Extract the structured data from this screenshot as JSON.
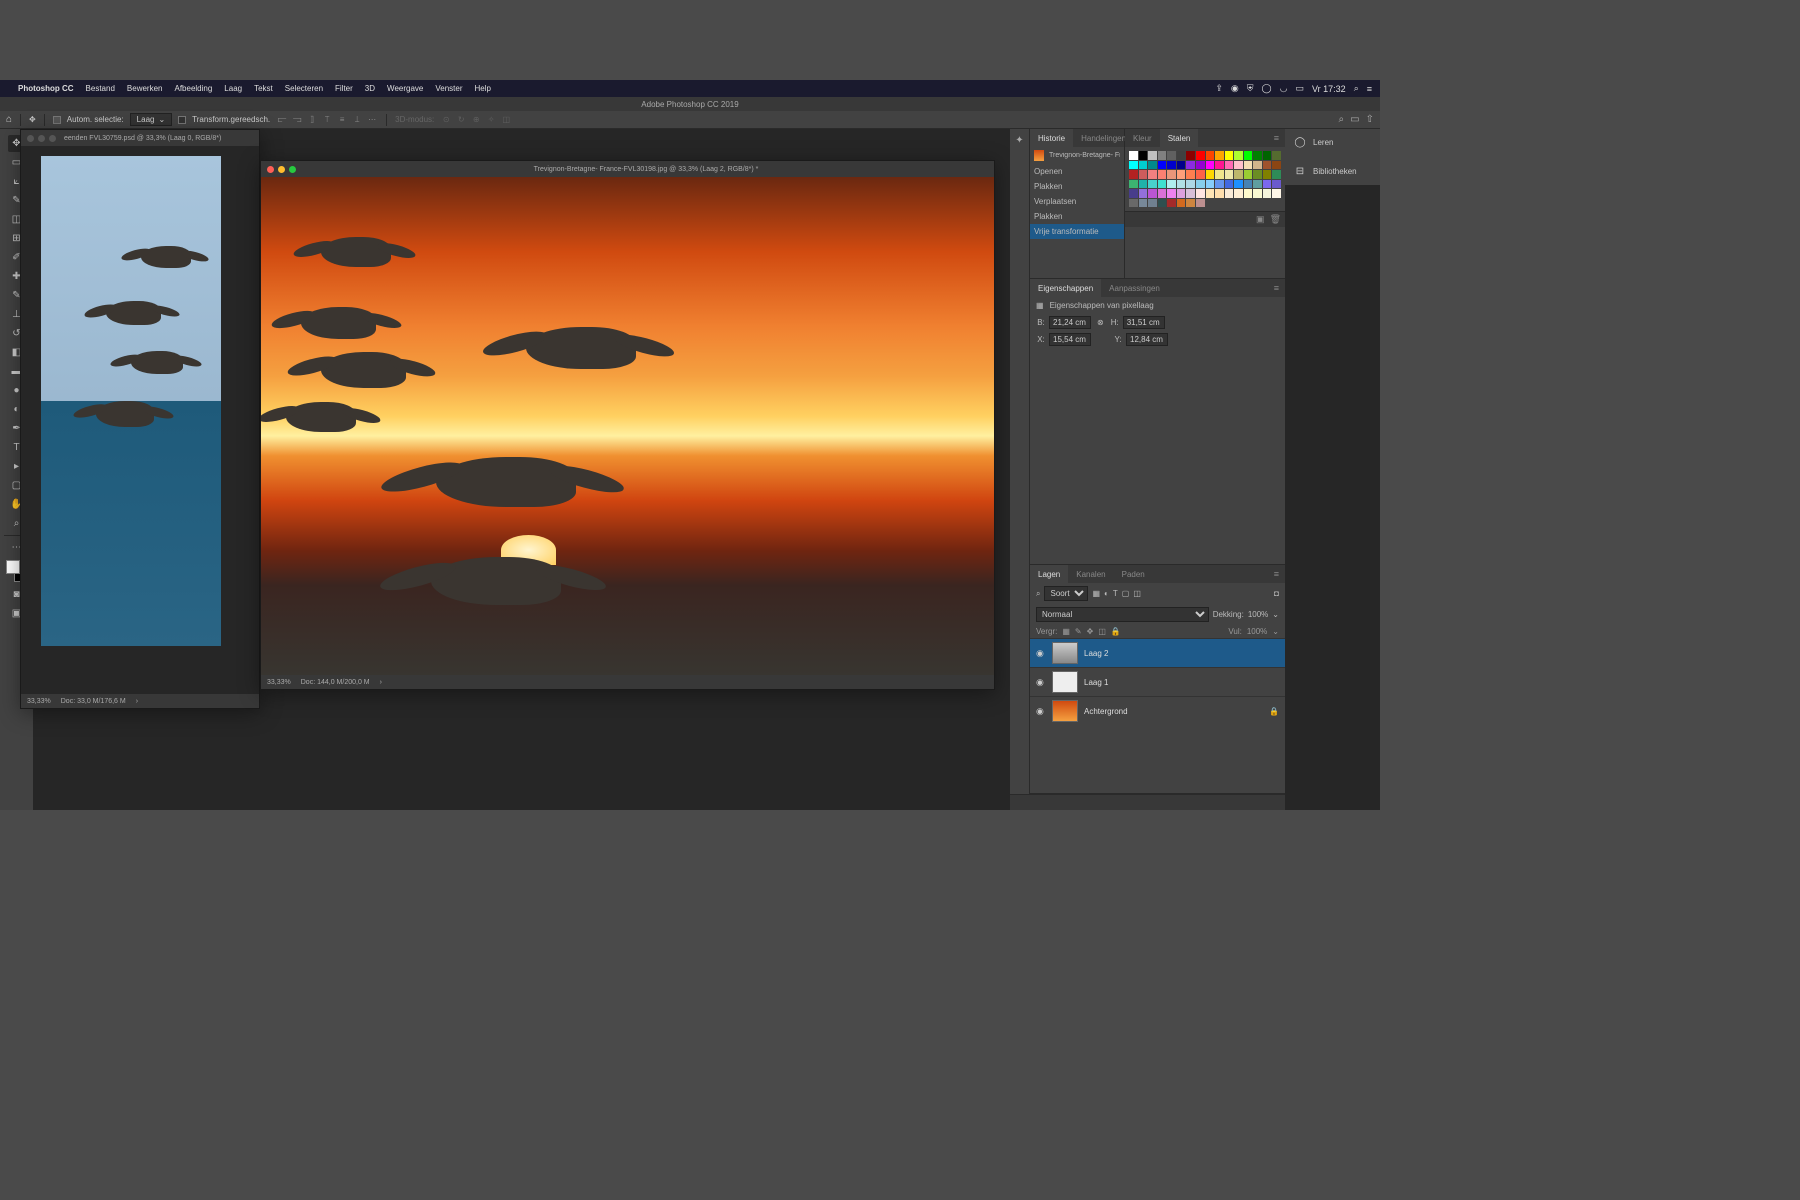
{
  "menubar": {
    "app": "Photoshop CC",
    "items": [
      "Bestand",
      "Bewerken",
      "Afbeelding",
      "Laag",
      "Tekst",
      "Selecteren",
      "Filter",
      "3D",
      "Weergave",
      "Venster",
      "Help"
    ],
    "clock": "Vr 17:32"
  },
  "titlebar": "Adobe Photoshop CC 2019",
  "optbar": {
    "auto_select": "Autom. selectie:",
    "auto_target": "Laag",
    "transform": "Transform.gereedsch.",
    "mode_3d": "3D-modus:"
  },
  "doc1": {
    "tab": "eenden FVL30759.psd @ 33,3% (Laag 0, RGB/8*)",
    "zoom": "33,33%",
    "docsize": "Doc: 33,0 M/176,6 M"
  },
  "doc2": {
    "tab": "Trevignon-Bretagne- France-FVL30198.jpg @ 33,3% (Laag 2, RGB/8*) *",
    "zoom": "33,33%",
    "docsize": "Doc: 144,0 M/200,0 M"
  },
  "history": {
    "tabs": [
      "Historie",
      "Handelingen"
    ],
    "snapshot": "Trevignon-Bretagne- France-F...",
    "items": [
      "Openen",
      "Plakken",
      "Verplaatsen",
      "Plakken",
      "Vrije transformatie"
    ]
  },
  "color": {
    "tabs": [
      "Kleur",
      "Stalen"
    ]
  },
  "props": {
    "tabs": [
      "Eigenschappen",
      "Aanpassingen"
    ],
    "title": "Eigenschappen van pixellaag",
    "w_label": "B:",
    "w": "21,24 cm",
    "h_label": "H:",
    "h": "31,51 cm",
    "x_label": "X:",
    "x": "15,54 cm",
    "y_label": "Y:",
    "y": "12,84 cm"
  },
  "layers": {
    "tabs": [
      "Lagen",
      "Kanalen",
      "Paden"
    ],
    "kind": "Soort",
    "blend": "Normaal",
    "opacity_label": "Dekking:",
    "opacity": "100%",
    "lock_label": "Vergr:",
    "fill_label": "Vul:",
    "fill": "100%",
    "rows": [
      {
        "name": "Laag 2"
      },
      {
        "name": "Laag 1"
      },
      {
        "name": "Achtergrond",
        "locked": true
      }
    ]
  },
  "collapsed": {
    "learn": "Leren",
    "libraries": "Bibliotheken"
  },
  "swatch_colors": [
    "#ffffff",
    "#000000",
    "#c0c0c0",
    "#808080",
    "#606060",
    "#404040",
    "#8b0000",
    "#ff0000",
    "#ff4500",
    "#ffa500",
    "#ffff00",
    "#adff2f",
    "#00ff00",
    "#008000",
    "#006400",
    "#556b2f",
    "#00ffff",
    "#00ced1",
    "#008b8b",
    "#0000ff",
    "#0000cd",
    "#00008b",
    "#8a2be2",
    "#9400d3",
    "#ff00ff",
    "#ff1493",
    "#ff69b4",
    "#ffc0cb",
    "#f5deb3",
    "#d2b48c",
    "#a0522d",
    "#8b4513",
    "#b22222",
    "#cd5c5c",
    "#f08080",
    "#fa8072",
    "#e9967a",
    "#ffa07a",
    "#ff7f50",
    "#ff6347",
    "#ffd700",
    "#f0e68c",
    "#eee8aa",
    "#bdb76b",
    "#9acd32",
    "#6b8e23",
    "#808000",
    "#2e8b57",
    "#3cb371",
    "#20b2aa",
    "#48d1cc",
    "#40e0d0",
    "#afeeee",
    "#b0e0e6",
    "#add8e6",
    "#87ceeb",
    "#87cefa",
    "#6495ed",
    "#4169e1",
    "#1e90ff",
    "#4682b4",
    "#5f9ea0",
    "#7b68ee",
    "#6a5acd",
    "#483d8b",
    "#9370db",
    "#ba55d3",
    "#da70d6",
    "#ee82ee",
    "#dda0dd",
    "#d8bfd8",
    "#ffe4e1",
    "#ffe4b5",
    "#ffdead",
    "#faebd7",
    "#ffefd5",
    "#fffacd",
    "#fafad2",
    "#f5f5dc",
    "#fdf5e6",
    "#696969",
    "#778899",
    "#708090",
    "#2f4f4f",
    "#a52a2a",
    "#d2691e",
    "#cd853f",
    "#bc8f8f"
  ]
}
